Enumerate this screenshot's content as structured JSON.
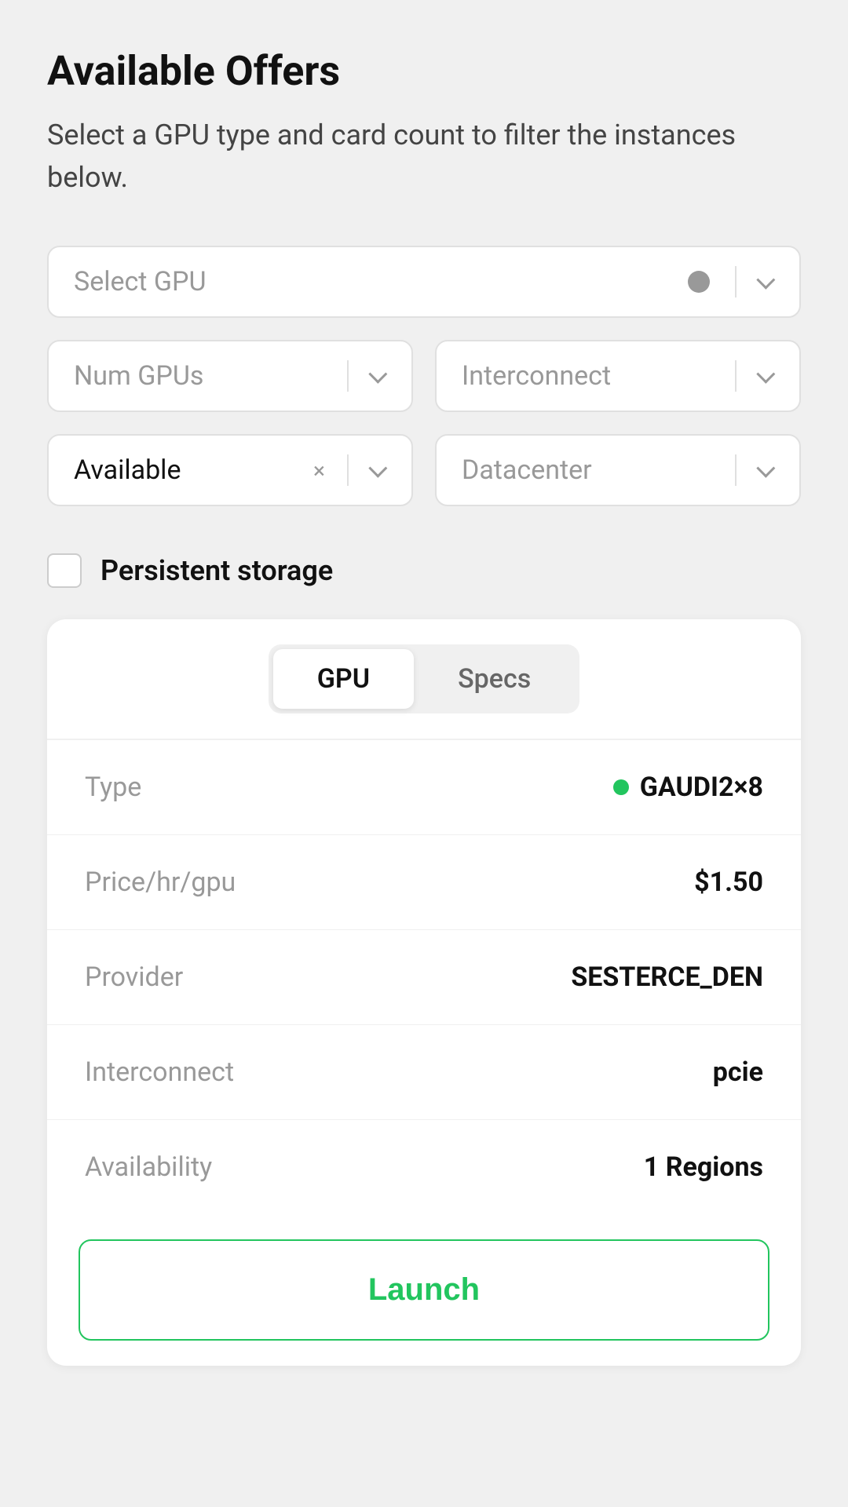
{
  "page": {
    "title": "Available Offers",
    "subtitle": "Select a GPU type and card count to filter the instances below."
  },
  "filters": {
    "gpu_select": {
      "placeholder": "Select GPU",
      "has_dot": true
    },
    "num_gpus": {
      "placeholder": "Num GPUs"
    },
    "interconnect": {
      "placeholder": "Interconnect"
    },
    "availability": {
      "value": "Available",
      "has_clear": true
    },
    "datacenter": {
      "placeholder": "Datacenter"
    },
    "persistent_storage": {
      "label": "Persistent storage",
      "checked": false
    }
  },
  "card": {
    "tabs": [
      {
        "id": "gpu",
        "label": "GPU",
        "active": true
      },
      {
        "id": "specs",
        "label": "Specs",
        "active": false
      }
    ],
    "details": [
      {
        "label": "Type",
        "value": "GAUDI2×8",
        "has_dot": true
      },
      {
        "label": "Price/hr/gpu",
        "value": "$1.50",
        "has_dot": false
      },
      {
        "label": "Provider",
        "value": "SESTERCE_DEN",
        "has_dot": false
      },
      {
        "label": "Interconnect",
        "value": "pcie",
        "has_dot": false
      },
      {
        "label": "Availability",
        "value": "1 Regions",
        "has_dot": false
      }
    ],
    "launch_button": "Launch"
  },
  "icons": {
    "chevron": "chevron-down-icon",
    "clear": "clear-icon",
    "status_dot": "status-dot-icon"
  }
}
